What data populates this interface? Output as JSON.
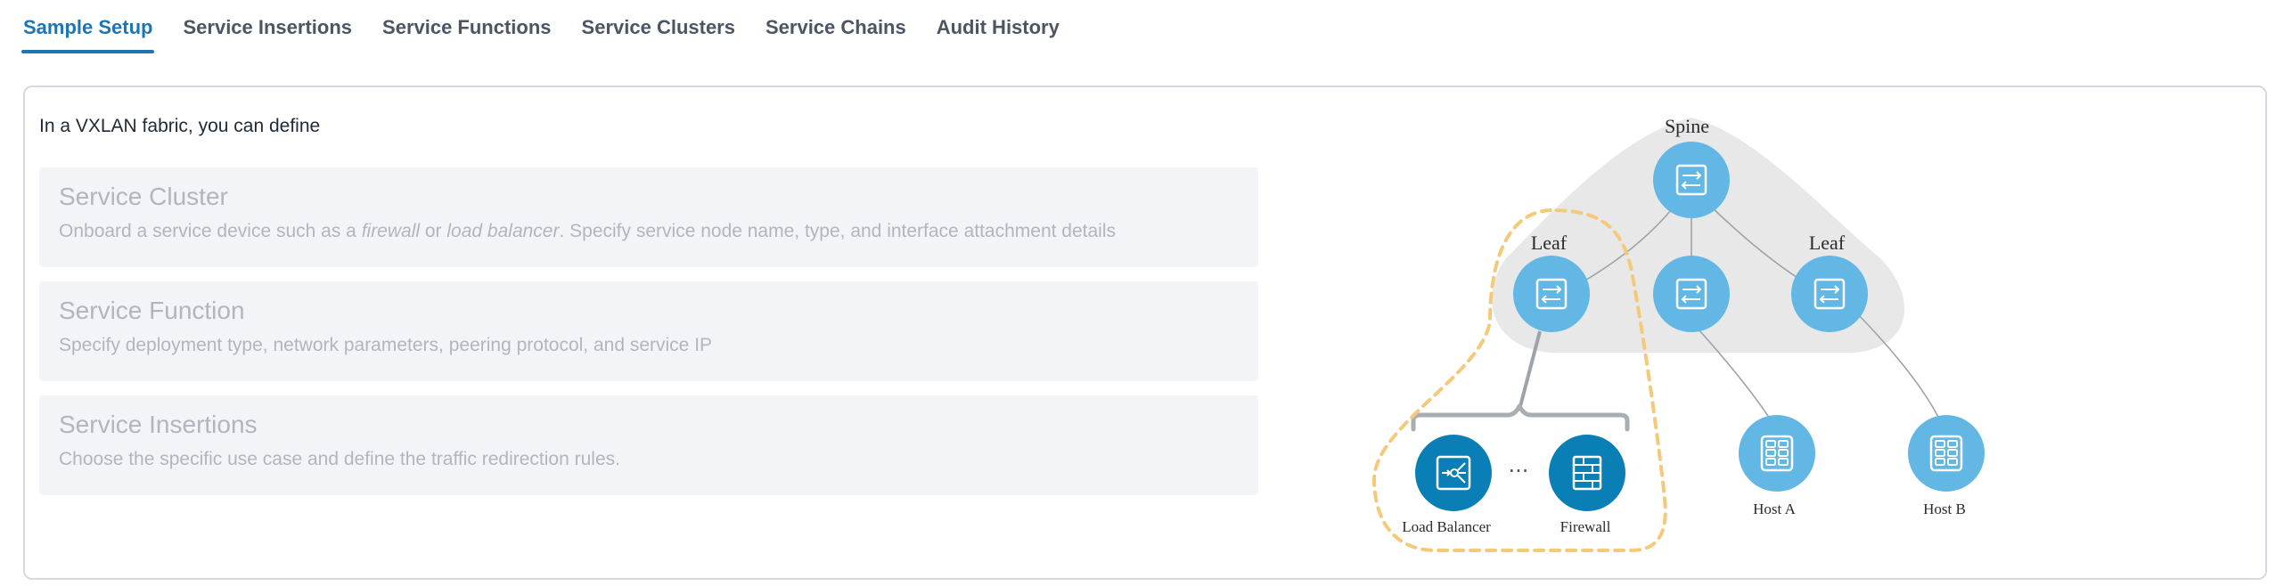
{
  "tabs": [
    {
      "label": "Sample Setup",
      "active": true
    },
    {
      "label": "Service Insertions",
      "active": false
    },
    {
      "label": "Service Functions",
      "active": false
    },
    {
      "label": "Service Clusters",
      "active": false
    },
    {
      "label": "Service Chains",
      "active": false
    },
    {
      "label": "Audit History",
      "active": false
    }
  ],
  "intro": "In a VXLAN fabric, you can define",
  "panels": [
    {
      "title": "Service Cluster",
      "desc_parts": [
        "Onboard a service device such as a ",
        "firewall",
        " or ",
        "load balancer",
        ". Specify service node name, type, and interface attachment details"
      ]
    },
    {
      "title": "Service Function",
      "desc": "Specify deployment type, network parameters, peering protocol, and service IP"
    },
    {
      "title": "Service Insertions",
      "desc": "Choose the specific use case and define the traffic redirection rules."
    }
  ],
  "diagram": {
    "spine_label": "Spine",
    "leaf_label_left": "Leaf",
    "leaf_label_right": "Leaf",
    "ellipsis": "···",
    "load_balancer_label": "Load Balancer",
    "firewall_label": "Firewall",
    "host_a_label": "Host A",
    "host_b_label": "Host B",
    "colors": {
      "switch": "#62b7e4",
      "service": "#0a7fb5",
      "fabric_bg": "#e8e8e8",
      "dashed_outline": "#f5c97a"
    }
  }
}
